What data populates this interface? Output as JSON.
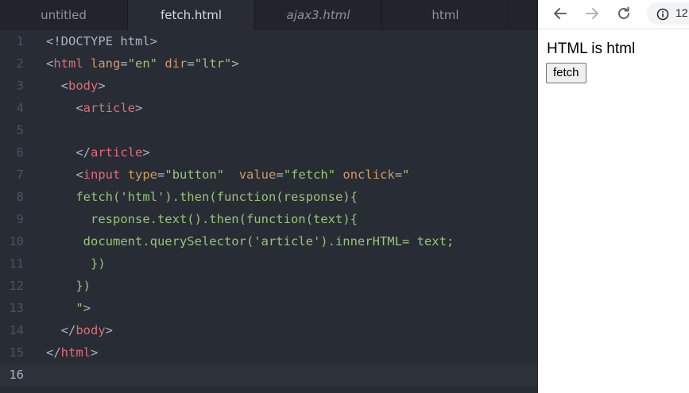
{
  "editor": {
    "tabs": [
      {
        "label": "untitled"
      },
      {
        "label": "fetch.html"
      },
      {
        "label": "ajax3.html"
      },
      {
        "label": "html"
      }
    ],
    "lines": [
      {
        "n": "1",
        "segs": [
          [
            "p",
            "<!DOCTYPE html>"
          ]
        ]
      },
      {
        "n": "2",
        "segs": [
          [
            "p",
            "<"
          ],
          [
            "t",
            "html"
          ],
          [
            "p",
            " "
          ],
          [
            "a",
            "lang"
          ],
          [
            "p",
            "="
          ],
          [
            "s",
            "\"en\""
          ],
          [
            "p",
            " "
          ],
          [
            "a",
            "dir"
          ],
          [
            "p",
            "="
          ],
          [
            "s",
            "\"ltr\""
          ],
          [
            "p",
            ">"
          ]
        ]
      },
      {
        "n": "3",
        "segs": [
          [
            "p",
            "  <"
          ],
          [
            "t",
            "body"
          ],
          [
            "p",
            ">"
          ]
        ]
      },
      {
        "n": "4",
        "segs": [
          [
            "p",
            "    <"
          ],
          [
            "t",
            "article"
          ],
          [
            "p",
            ">"
          ]
        ]
      },
      {
        "n": "5",
        "segs": []
      },
      {
        "n": "6",
        "segs": [
          [
            "p",
            "    </"
          ],
          [
            "t",
            "article"
          ],
          [
            "p",
            ">"
          ]
        ]
      },
      {
        "n": "7",
        "segs": [
          [
            "p",
            "    <"
          ],
          [
            "t",
            "input"
          ],
          [
            "p",
            " "
          ],
          [
            "a",
            "type"
          ],
          [
            "p",
            "="
          ],
          [
            "s",
            "\"button\""
          ],
          [
            "p",
            "  "
          ],
          [
            "a",
            "value"
          ],
          [
            "p",
            "="
          ],
          [
            "s",
            "\"fetch\""
          ],
          [
            "p",
            " "
          ],
          [
            "a",
            "onclick"
          ],
          [
            "p",
            "="
          ],
          [
            "s",
            "\""
          ]
        ]
      },
      {
        "n": "8",
        "segs": [
          [
            "g",
            "    fetch('html').then(function(response){"
          ]
        ]
      },
      {
        "n": "9",
        "segs": [
          [
            "g",
            "      response.text().then(function(text){"
          ]
        ]
      },
      {
        "n": "10",
        "segs": [
          [
            "g",
            "     document.querySelector('article').innerHTML= text;"
          ]
        ]
      },
      {
        "n": "11",
        "segs": [
          [
            "g",
            "      })"
          ]
        ]
      },
      {
        "n": "12",
        "segs": [
          [
            "g",
            "    })"
          ]
        ]
      },
      {
        "n": "13",
        "segs": [
          [
            "s",
            "    \""
          ],
          [
            "p",
            ">"
          ]
        ]
      },
      {
        "n": "14",
        "segs": [
          [
            "p",
            "  </"
          ],
          [
            "t",
            "body"
          ],
          [
            "p",
            ">"
          ]
        ]
      },
      {
        "n": "15",
        "segs": [
          [
            "p",
            "</"
          ],
          [
            "t",
            "html"
          ],
          [
            "p",
            ">"
          ]
        ]
      },
      {
        "n": "16",
        "segs": []
      }
    ],
    "current_line": "16"
  },
  "browser": {
    "address_partial": "12",
    "article_text": "HTML is html",
    "fetch_button_label": "fetch",
    "icons": [
      "back-arrow-icon",
      "forward-arrow-icon",
      "reload-icon",
      "info-icon"
    ]
  }
}
